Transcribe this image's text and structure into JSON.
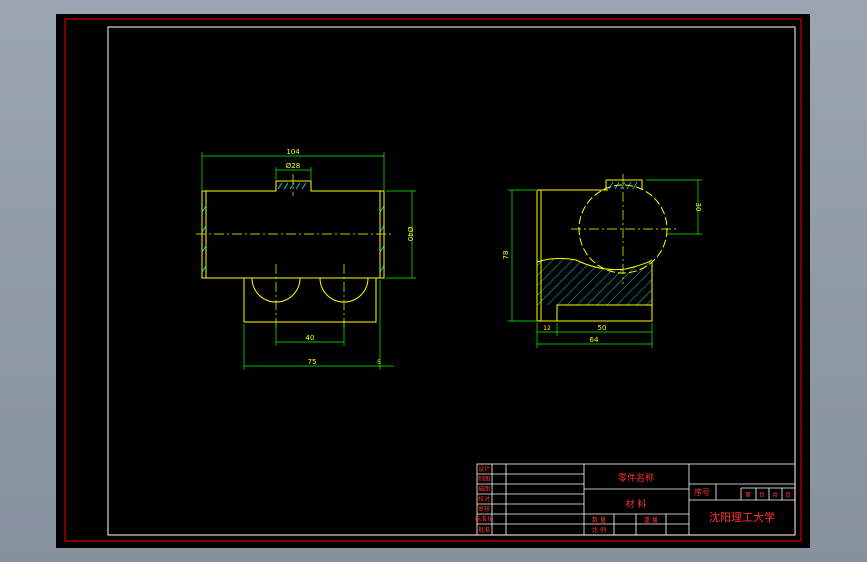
{
  "colors": {
    "background": "#000000",
    "frame": "#ff0000",
    "border": "#ffffff",
    "outline": "#ffff00",
    "dimension": "#00ff00",
    "centerline": "#ffff00",
    "hatch": "#00ffff",
    "titleblock_text": "#ff3333"
  },
  "front_view": {
    "dims": {
      "overall_length": "104",
      "boss_diameter": "Ø28",
      "height": "Ø40",
      "hole_spacing": "40",
      "base_length": "75",
      "base_offset": "5"
    }
  },
  "side_view": {
    "dims": {
      "height": "78",
      "sphere_radius": "30",
      "offset_left": "12",
      "inner_width": "50",
      "overall_width": "64"
    }
  },
  "title_block": {
    "part_name": "零件名称",
    "material": "材  料",
    "seq_no": "序号",
    "school": "沈阳理工大学",
    "scale_label": "比  例",
    "quantity_label": "数  量",
    "weight_label": "重  量",
    "sheet_labels": [
      "第",
      "页",
      "共",
      "页"
    ],
    "row_labels": [
      "设计",
      "制图",
      "描图",
      "校对",
      "审核",
      "标准化",
      "批准"
    ]
  }
}
